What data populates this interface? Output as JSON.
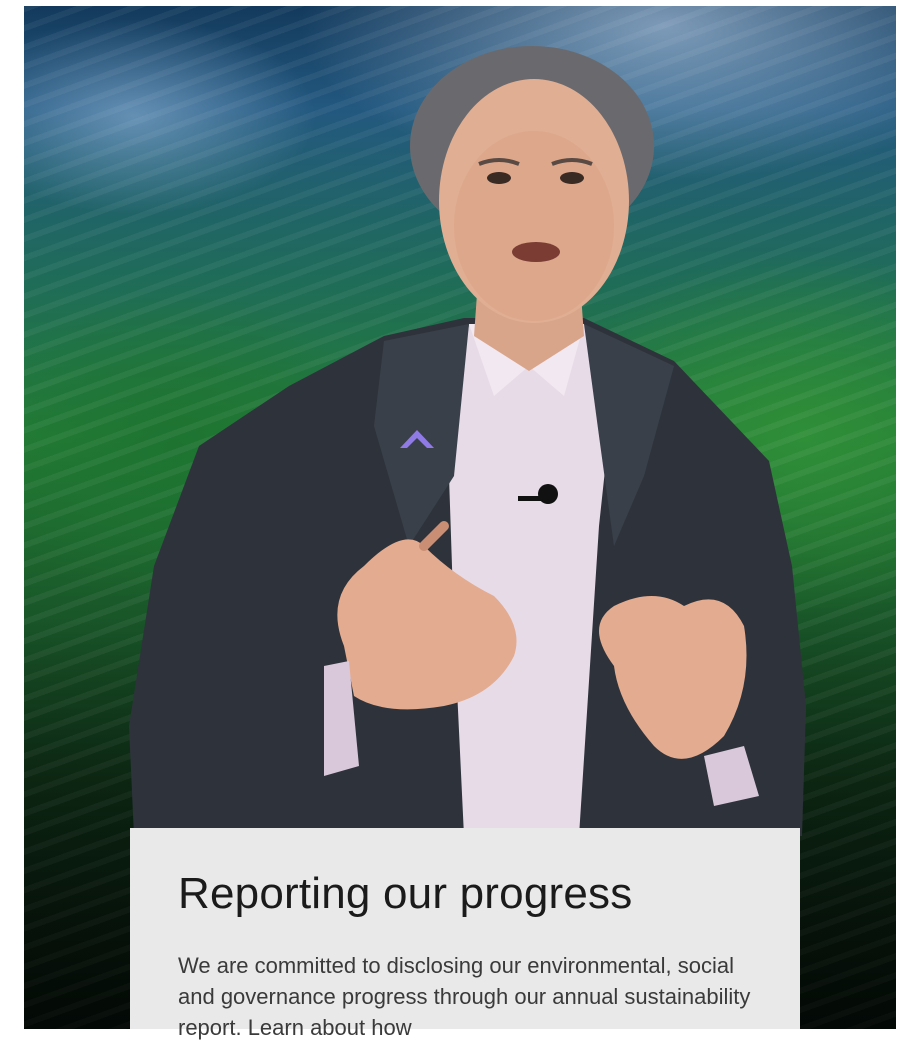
{
  "hero": {
    "image": "speaker-on-stage-with-green-landscape-backdrop",
    "badge_icon": "chevron-up-icon",
    "accent_color": "#8f7ae6"
  },
  "card": {
    "title": "Reporting our progress",
    "body": "We are committed to disclosing our environmental, social and governance progress through our annual sustainability report. Learn about how",
    "background": "#e9e9e9"
  }
}
